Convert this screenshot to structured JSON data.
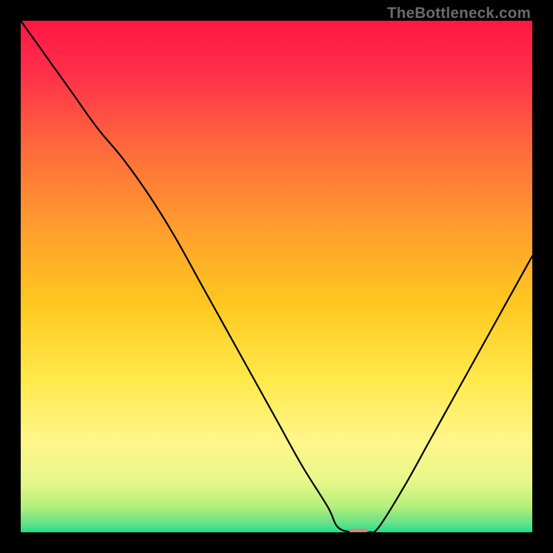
{
  "watermark": "TheBottleneck.com",
  "chart_data": {
    "type": "line",
    "title": "",
    "xlabel": "",
    "ylabel": "",
    "xlim": [
      0,
      100
    ],
    "ylim": [
      0,
      100
    ],
    "grid": false,
    "legend": false,
    "background": {
      "description": "Vertical gradient, red at top through orange/yellow to green at bottom",
      "stops": [
        {
          "offset": 0.0,
          "color": "#ff1744"
        },
        {
          "offset": 0.1,
          "color": "#ff2e4a"
        },
        {
          "offset": 0.25,
          "color": "#ff6a3c"
        },
        {
          "offset": 0.4,
          "color": "#ff9c2e"
        },
        {
          "offset": 0.55,
          "color": "#ffc71f"
        },
        {
          "offset": 0.7,
          "color": "#ffe94a"
        },
        {
          "offset": 0.82,
          "color": "#fff68a"
        },
        {
          "offset": 0.9,
          "color": "#e8f78a"
        },
        {
          "offset": 0.95,
          "color": "#b4f07a"
        },
        {
          "offset": 0.985,
          "color": "#5fe08a"
        },
        {
          "offset": 1.0,
          "color": "#19e08a"
        }
      ]
    },
    "series": [
      {
        "name": "bottleneck-curve",
        "color": "#000000",
        "x": [
          0,
          5,
          10,
          15,
          20,
          25,
          30,
          35,
          40,
          45,
          50,
          55,
          60,
          62,
          65,
          68,
          70,
          75,
          80,
          85,
          90,
          95,
          100
        ],
        "y": [
          100,
          93,
          86,
          79,
          73,
          66,
          58,
          49,
          40,
          31,
          22,
          13,
          5,
          1,
          0,
          0,
          1,
          9,
          18,
          27,
          36,
          45,
          54
        ]
      }
    ],
    "marker": {
      "name": "optimal-point",
      "shape": "rounded-rect",
      "color": "#d9847f",
      "x": 66,
      "y": 0,
      "width_pct": 3.5,
      "height_pct": 1.4
    }
  }
}
